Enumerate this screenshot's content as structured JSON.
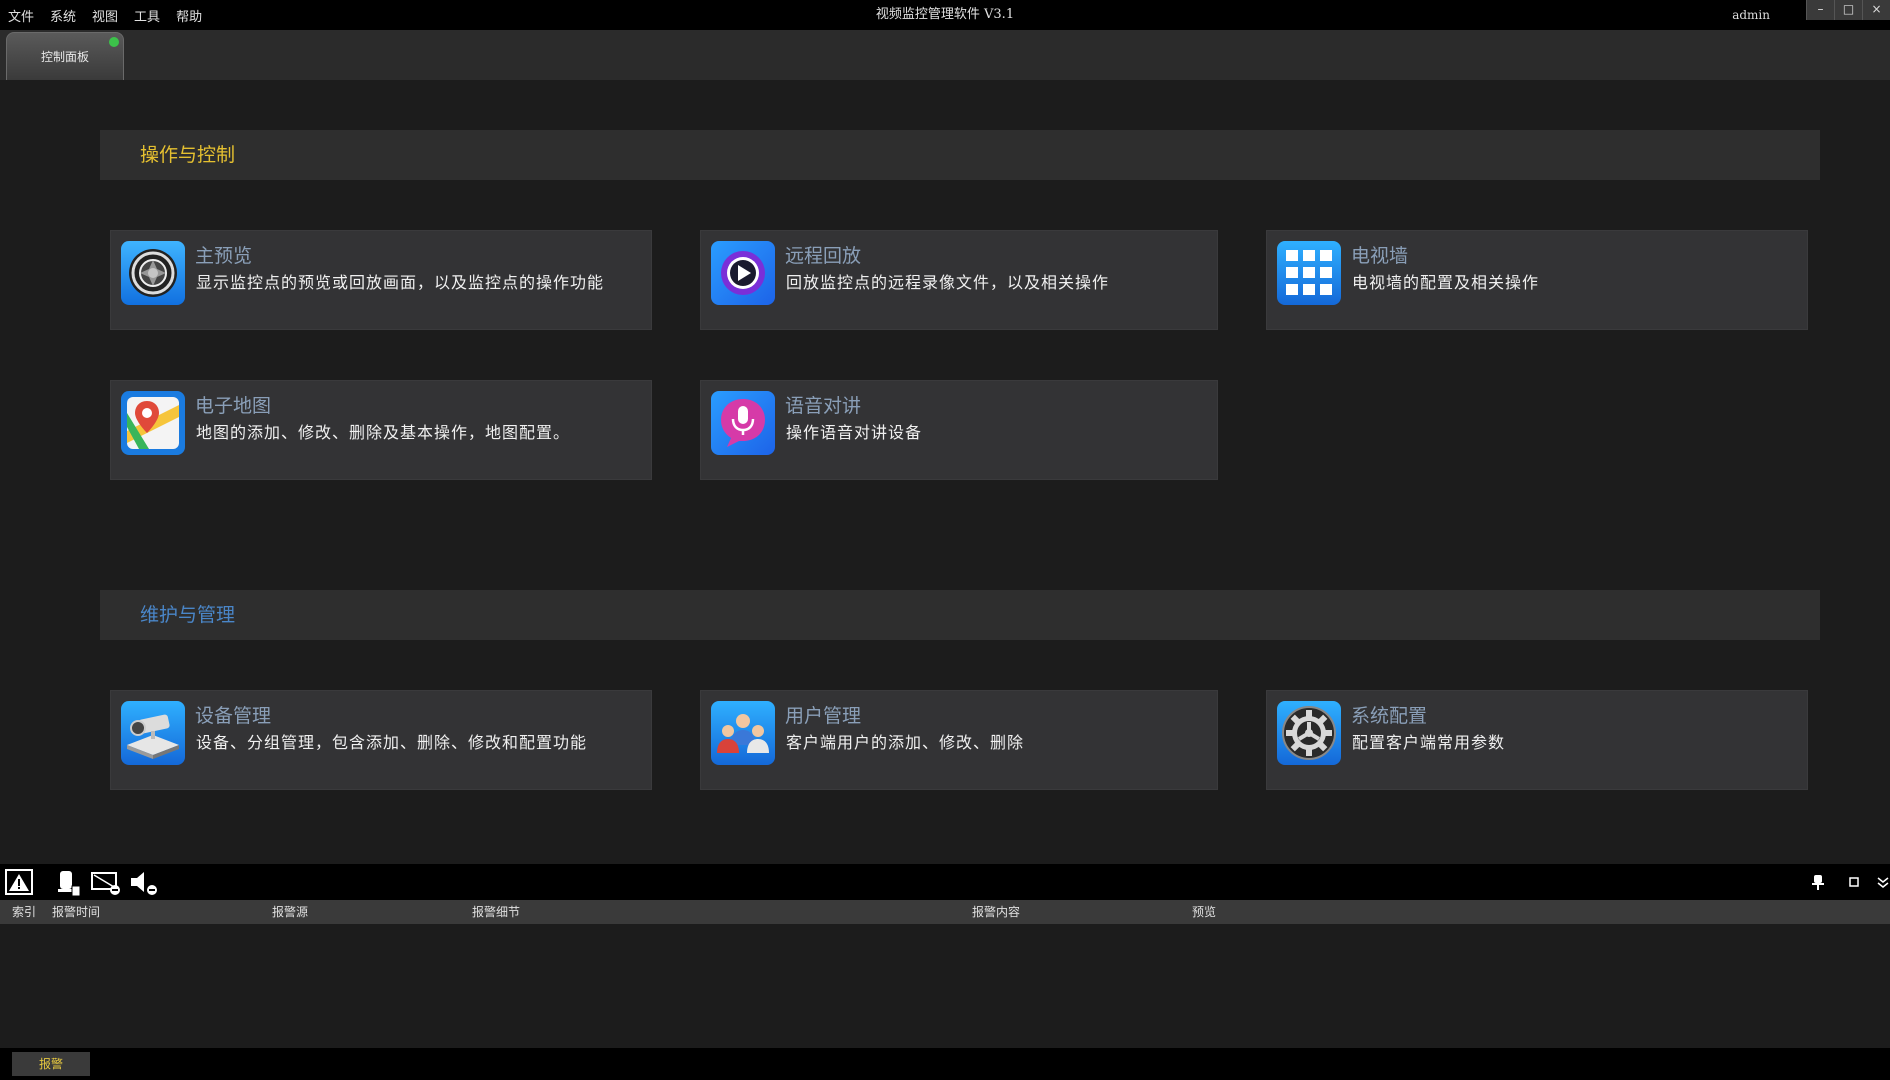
{
  "menu": [
    "文件",
    "系统",
    "视图",
    "工具",
    "帮助"
  ],
  "app_title": "视频监控管理软件 V3.1",
  "user": "admin",
  "window_controls": [
    "–",
    "□",
    "×"
  ],
  "tab": {
    "label": "控制面板"
  },
  "sections": [
    {
      "title": "操作与控制",
      "color": "#e5c030",
      "cards": [
        {
          "title": "主预览",
          "desc": "显示监控点的预览或回放画面，以及监控点的操作功能",
          "icon": "camera-lens-icon"
        },
        {
          "title": "远程回放",
          "desc": "回放监控点的远程录像文件，以及相关操作",
          "icon": "play-icon"
        },
        {
          "title": "电视墙",
          "desc": "电视墙的配置及相关操作",
          "icon": "grid-icon"
        },
        {
          "title": "电子地图",
          "desc": "地图的添加、修改、删除及基本操作，地图配置。",
          "icon": "map-pin-icon"
        },
        {
          "title": "语音对讲",
          "desc": "操作语音对讲设备",
          "icon": "microphone-icon"
        }
      ]
    },
    {
      "title": "维护与管理",
      "color": "#4a86c8",
      "cards": [
        {
          "title": "设备管理",
          "desc": "设备、分组管理，包含添加、删除、修改和配置功能",
          "icon": "device-icon"
        },
        {
          "title": "用户管理",
          "desc": "客户端用户的添加、修改、删除",
          "icon": "users-icon"
        },
        {
          "title": "系统配置",
          "desc": "配置客户端常用参数",
          "icon": "gear-icon"
        }
      ]
    }
  ],
  "alarm_table": {
    "columns": [
      "索引",
      "报警时间",
      "报警源",
      "报警细节",
      "报警内容",
      "预览"
    ]
  },
  "status_tab": "报警"
}
